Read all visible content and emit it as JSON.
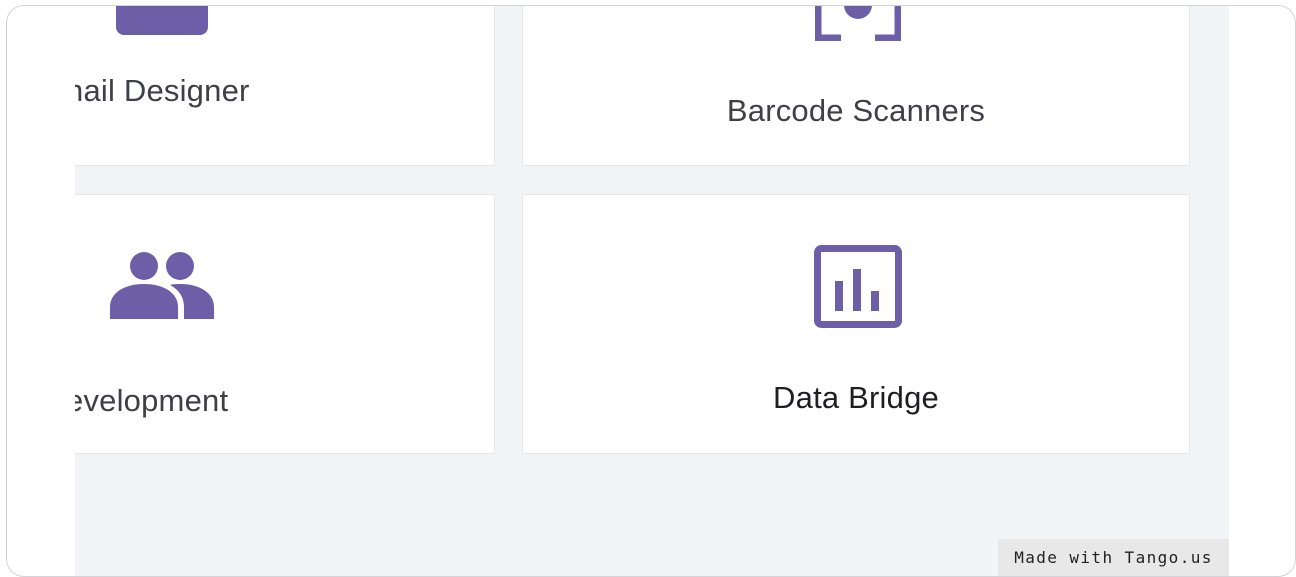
{
  "colors": {
    "accent": "#6c5fa7",
    "card_text": "#3f3f46",
    "card_text_strong": "#1f1f23",
    "page_bg": "#f3f4f6",
    "card_bg": "#ffffff"
  },
  "cards": [
    {
      "label": "nail Designer",
      "icon": "email-designer-icon"
    },
    {
      "label": "Barcode Scanners",
      "icon": "barcode-scanner-icon"
    },
    {
      "label": "evelopment",
      "icon": "users-icon"
    },
    {
      "label": "Data Bridge",
      "icon": "bar-chart-icon"
    }
  ],
  "watermark": {
    "text": "Made with Tango.us"
  }
}
